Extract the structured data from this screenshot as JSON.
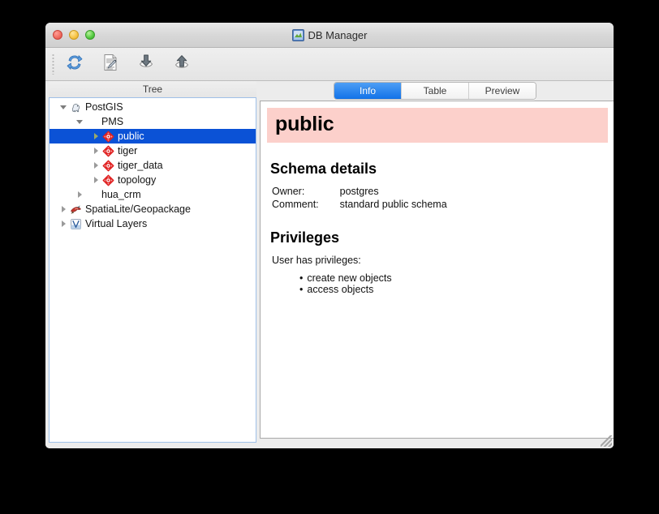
{
  "window": {
    "title": "DB Manager",
    "title_icon": "database-layers-icon",
    "controls": {
      "close_label": "close",
      "minimize_label": "minimize",
      "zoom_label": "zoom"
    }
  },
  "toolbar": {
    "buttons": [
      {
        "name": "refresh-button",
        "icon": "refresh-icon",
        "tooltip": "Refresh"
      },
      {
        "name": "sql-window-button",
        "icon": "sql-window-icon",
        "tooltip": "SQL window"
      },
      {
        "name": "import-layer-button",
        "icon": "import-down-arrow-icon",
        "tooltip": "Import layer/file"
      },
      {
        "name": "export-layer-button",
        "icon": "export-up-arrow-icon",
        "tooltip": "Export to file"
      }
    ]
  },
  "tree_panel": {
    "header": "Tree",
    "items": [
      {
        "label": "PostGIS",
        "icon": "postgis-elephant-icon",
        "indent": 0,
        "twisty": "down",
        "selected": false
      },
      {
        "label": "PMS",
        "icon": "none",
        "indent": 1,
        "twisty": "down",
        "selected": false
      },
      {
        "label": "public",
        "icon": "schema-diamond-icon",
        "indent": 2,
        "twisty": "right",
        "selected": true
      },
      {
        "label": "tiger",
        "icon": "schema-diamond-icon",
        "indent": 2,
        "twisty": "right",
        "selected": false
      },
      {
        "label": "tiger_data",
        "icon": "schema-diamond-icon",
        "indent": 2,
        "twisty": "right",
        "selected": false
      },
      {
        "label": "topology",
        "icon": "schema-diamond-icon",
        "indent": 2,
        "twisty": "right",
        "selected": false
      },
      {
        "label": "hua_crm",
        "icon": "none",
        "indent": 1,
        "twisty": "right",
        "selected": false
      },
      {
        "label": "SpatiaLite/Geopackage",
        "icon": "spatialite-bird-icon",
        "indent": 0,
        "twisty": "right",
        "selected": false
      },
      {
        "label": "Virtual Layers",
        "icon": "virtual-layers-icon",
        "indent": 0,
        "twisty": "right",
        "selected": false
      }
    ]
  },
  "tabs": [
    {
      "label": "Info",
      "active": true
    },
    {
      "label": "Table",
      "active": false
    },
    {
      "label": "Preview",
      "active": false
    }
  ],
  "info_page": {
    "schema_name": "public",
    "sections": [
      {
        "heading": "Schema details",
        "rows": [
          {
            "key": "Owner:",
            "value": "postgres"
          },
          {
            "key": "Comment:",
            "value": "standard public schema"
          }
        ]
      },
      {
        "heading": "Privileges",
        "lead": "User has privileges:",
        "bullets": [
          "create new objects",
          "access objects"
        ]
      }
    ]
  },
  "colors": {
    "selection_blue": "#0b52d6",
    "tab_active_blue": "#1272e8",
    "banner_pink": "#fcd0cb",
    "window_chrome": "#ececec",
    "tree_focus_border": "#9fc0e8"
  }
}
